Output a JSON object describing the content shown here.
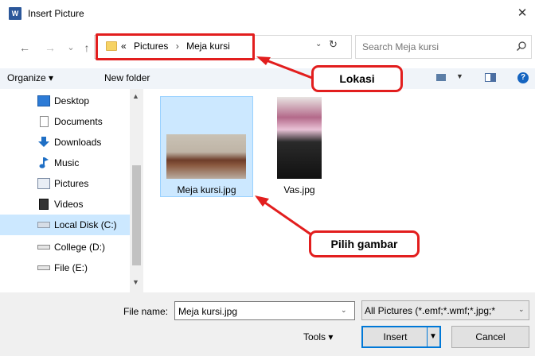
{
  "window": {
    "app_icon": "W",
    "title": "Insert Picture",
    "close_glyph": "✕"
  },
  "navigation": {
    "back_glyph": "←",
    "forward_glyph": "→",
    "recent_glyph": "⌄",
    "up_glyph": "↑",
    "breadcrumb_prefix": "«",
    "breadcrumb": [
      "Pictures",
      "Meja kursi"
    ],
    "breadcrumb_sep": "›",
    "dropdown_glyph": "⌄",
    "refresh_glyph": "↻"
  },
  "search": {
    "placeholder": "Search Meja kursi"
  },
  "toolbar": {
    "organize_label": "Organize ▾",
    "new_folder_label": "New folder",
    "view_dd_glyph": "▼",
    "help_glyph": "?"
  },
  "sidebar": {
    "items": [
      {
        "label": "Desktop",
        "icon": "desktop-icon"
      },
      {
        "label": "Documents",
        "icon": "documents-icon"
      },
      {
        "label": "Downloads",
        "icon": "downloads-icon"
      },
      {
        "label": "Music",
        "icon": "music-icon"
      },
      {
        "label": "Pictures",
        "icon": "pictures-icon"
      },
      {
        "label": "Videos",
        "icon": "videos-icon"
      },
      {
        "label": "Local Disk (C:)",
        "icon": "local-disk-icon",
        "selected": true
      },
      {
        "label": "College (D:)",
        "icon": "drive-icon"
      },
      {
        "label": "File (E:)",
        "icon": "drive-icon"
      }
    ],
    "scroll_up_glyph": "▲",
    "scroll_down_glyph": "▼"
  },
  "files": [
    {
      "name": "Meja kursi.jpg",
      "selected": true
    },
    {
      "name": "Vas.jpg",
      "selected": false
    }
  ],
  "annotations": {
    "lokasi": "Lokasi",
    "pilih": "Pilih gambar",
    "color": "#e21e1e"
  },
  "footer": {
    "file_name_label": "File name:",
    "file_name_value": "Meja kursi.jpg",
    "file_name_dd_glyph": "⌄",
    "filter_label": "All Pictures (*.emf;*.wmf;*.jpg;*",
    "filter_dd_glyph": "⌄",
    "tools_label": "Tools  ▾",
    "insert_label": "Insert",
    "insert_dd_glyph": "▼",
    "cancel_label": "Cancel"
  },
  "colors": {
    "accent": "#0078d7",
    "selection": "#cce8ff",
    "annotation": "#e21e1e"
  }
}
